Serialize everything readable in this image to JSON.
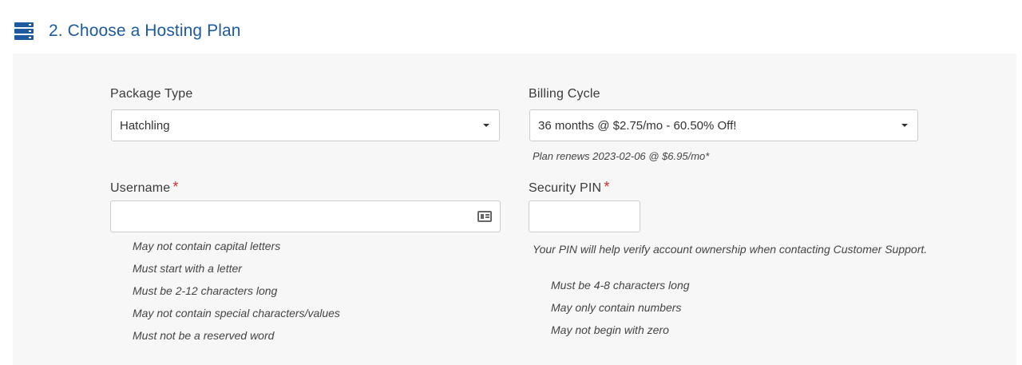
{
  "section": {
    "title": "2. Choose a Hosting Plan"
  },
  "package": {
    "label": "Package Type",
    "value": "Hatchling"
  },
  "billing": {
    "label": "Billing Cycle",
    "value": "36 months @ $2.75/mo - 60.50% Off!",
    "renew_note": "Plan renews 2023-02-06 @ $6.95/mo*"
  },
  "username": {
    "label": "Username",
    "required_mark": "*",
    "value": "",
    "rules": [
      "May not contain capital letters",
      "Must start with a letter",
      "Must be 2-12 characters long",
      "May not contain special characters/values",
      "Must not be a reserved word"
    ]
  },
  "pin": {
    "label": "Security PIN",
    "required_mark": "*",
    "value": "",
    "note": "Your PIN will help verify account ownership when contacting Customer Support.",
    "rules": [
      "Must be 4-8 characters long",
      "May only contain numbers",
      "May not begin with zero"
    ]
  },
  "colors": {
    "accent": "#1d5ba0",
    "required": "#c9302c",
    "panel_bg": "#f7f7f7"
  },
  "icons": {
    "section": "server-icon",
    "username_field": "contact-card-icon",
    "select_caret": "caret-down-icon"
  }
}
